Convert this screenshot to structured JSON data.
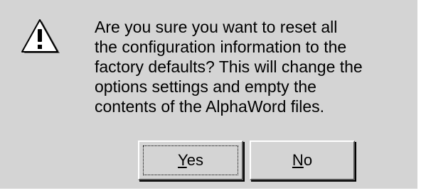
{
  "dialog": {
    "icon": "exclamation-warning-icon",
    "message": "Are you sure you want to reset all\nthe configuration information to the\nfactory defaults? This will change the\noptions settings and empty the\ncontents of the AlphaWord files."
  },
  "buttons": {
    "yes": {
      "mnemonic": "Y",
      "rest": "es",
      "focused": true
    },
    "no": {
      "mnemonic": "N",
      "rest": "o",
      "focused": false
    }
  },
  "colors": {
    "dialog_bg": "#d4d4d4",
    "text": "#000000",
    "highlight": "#ffffff",
    "shadow": "#555555"
  }
}
